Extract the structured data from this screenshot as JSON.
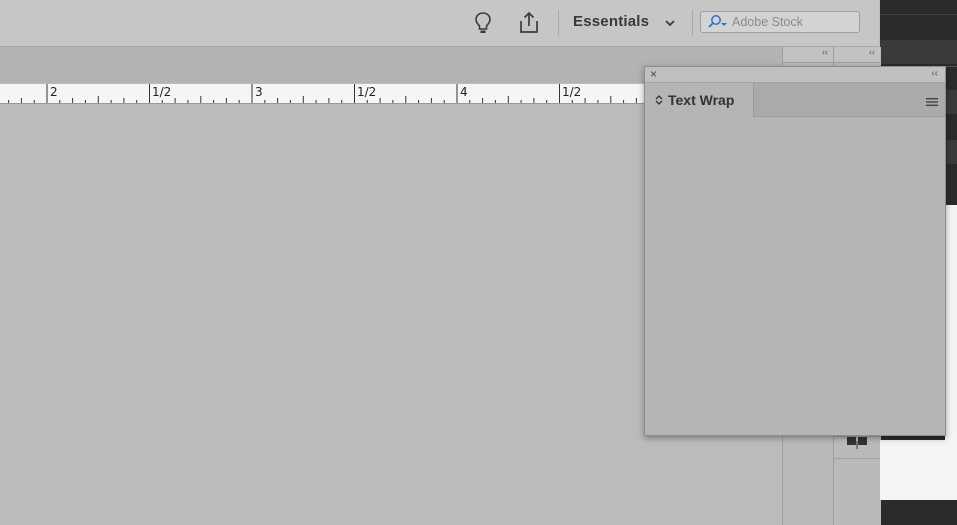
{
  "app_bar": {
    "workspace_label": "Essentials",
    "stock_search_placeholder": "Adobe Stock",
    "icons": [
      "lightbulb-icon",
      "share-icon",
      "chevron-down-icon",
      "search-icon"
    ]
  },
  "ruler": {
    "labels": [
      "2",
      "1/2",
      "3",
      "1/2",
      "4",
      "1/2"
    ]
  },
  "panel": {
    "tab_label": "Text Wrap",
    "close_glyph": "×",
    "collapse_glyph": "‹‹"
  },
  "dock": {
    "collapse_glyph_a": "‹‹",
    "collapse_glyph_b": "‹‹"
  },
  "colors": {
    "pasteboard": "#bbbbbb",
    "appbar": "#c6c6c6",
    "panel": "#b5b5b5",
    "stock_field": "#d3d3d3",
    "accent_search": "#2f6fd6"
  }
}
